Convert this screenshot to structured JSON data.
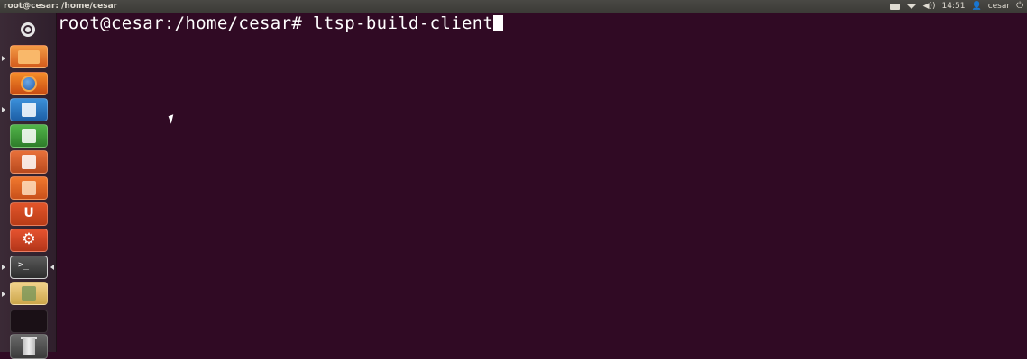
{
  "window": {
    "title": "root@cesar: /home/cesar"
  },
  "tray": {
    "time": "14:51",
    "user": "cesar"
  },
  "terminal": {
    "prompt": "root@cesar:/home/cesar# ",
    "command": "ltsp-build-client",
    "background": "#300a24"
  },
  "launcher": {
    "items": [
      "dash-home-icon",
      "files-icon",
      "firefox-icon",
      "writer-icon",
      "calc-icon",
      "impress-icon",
      "software-center-icon",
      "ubuntu-one-icon",
      "settings-icon",
      "terminal-icon",
      "update-manager-icon",
      "workspaces-icon",
      "trash-icon"
    ],
    "terminal_glyph": ">_"
  }
}
